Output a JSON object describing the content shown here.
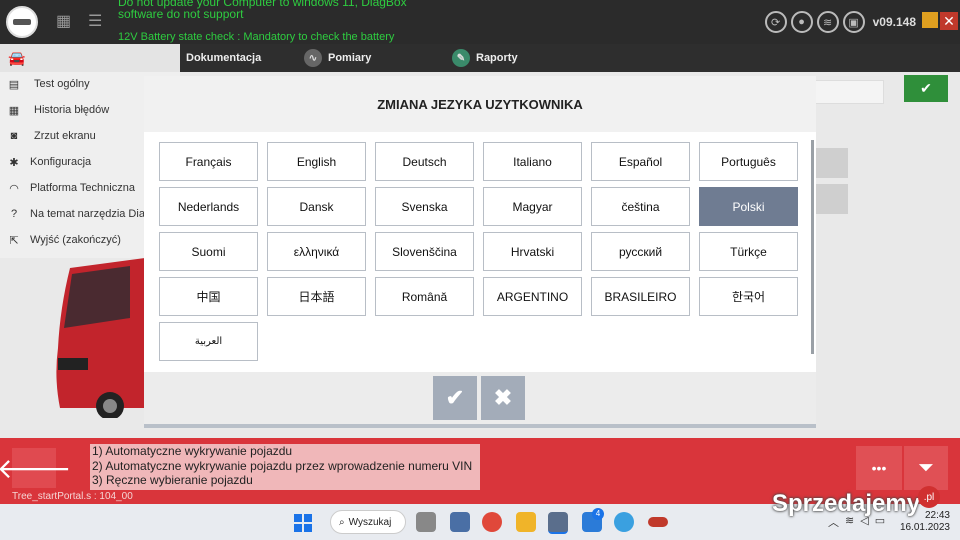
{
  "header": {
    "notice_line1": "Do not update your Computer to windows 11, DiagBox",
    "notice_line2": "software do not support",
    "notice_line3": "12V Battery state check : Mandatory to check the battery",
    "version": "v09.148"
  },
  "tabs": [
    {
      "label": "Dokumentacja",
      "icon": "document-icon"
    },
    {
      "label": "Pomiary",
      "icon": "waveform-icon"
    },
    {
      "label": "Raporty",
      "icon": "report-icon"
    }
  ],
  "sidemenu": {
    "items": [
      {
        "label": "Test ogólny",
        "icon": "list-icon"
      },
      {
        "label": "Historia błędów",
        "icon": "history-icon"
      },
      {
        "label": "Zrzut ekranu",
        "icon": "camera-icon"
      },
      {
        "label": "Konfiguracja",
        "icon": "gear-icon"
      },
      {
        "label": "Platforma Techniczna",
        "icon": "headset-icon"
      },
      {
        "label": "Na temat narzędzia Diagl",
        "icon": "help-icon"
      },
      {
        "label": "Wyjść (zakończyć)",
        "icon": "exit-icon"
      }
    ]
  },
  "modal": {
    "title": "ZMIANA JEZYKA UZYTKOWNIKA",
    "selected": "Polski",
    "languages": [
      [
        "Français",
        "English",
        "Deutsch",
        "Italiano",
        "Español",
        "Português"
      ],
      [
        "Nederlands",
        "Dansk",
        "Svenska",
        "Magyar",
        "čeština",
        "Polski"
      ],
      [
        "Suomi",
        "ελληνικά",
        "Slovenščina",
        "Hrvatski",
        "русский",
        "Türkçe"
      ],
      [
        "中国",
        "日本語",
        "Română",
        "ARGENTINO",
        "BRASILEIRO",
        "한국어"
      ],
      [
        "العربية"
      ]
    ]
  },
  "bottom": {
    "info_lines": [
      "1) Automatyczne wykrywanie pojazdu",
      "2) Automatyczne wykrywanie pojazdu przez wprowadzenie numeru VIN",
      "3) Ręczne wybieranie pojazdu"
    ],
    "status": "Tree_startPortal.s : 104_00"
  },
  "taskbar": {
    "search_label": "Wyszukaj",
    "time": "22:43",
    "date": "16.01.2023",
    "badge_count": "4"
  },
  "watermark": {
    "text": "Sprzedajemy",
    "badge": ".pl"
  },
  "colors": {
    "accent_green": "#2f8f3a",
    "bottom_red": "#d9353b",
    "selected_lang": "#6f7c92"
  }
}
